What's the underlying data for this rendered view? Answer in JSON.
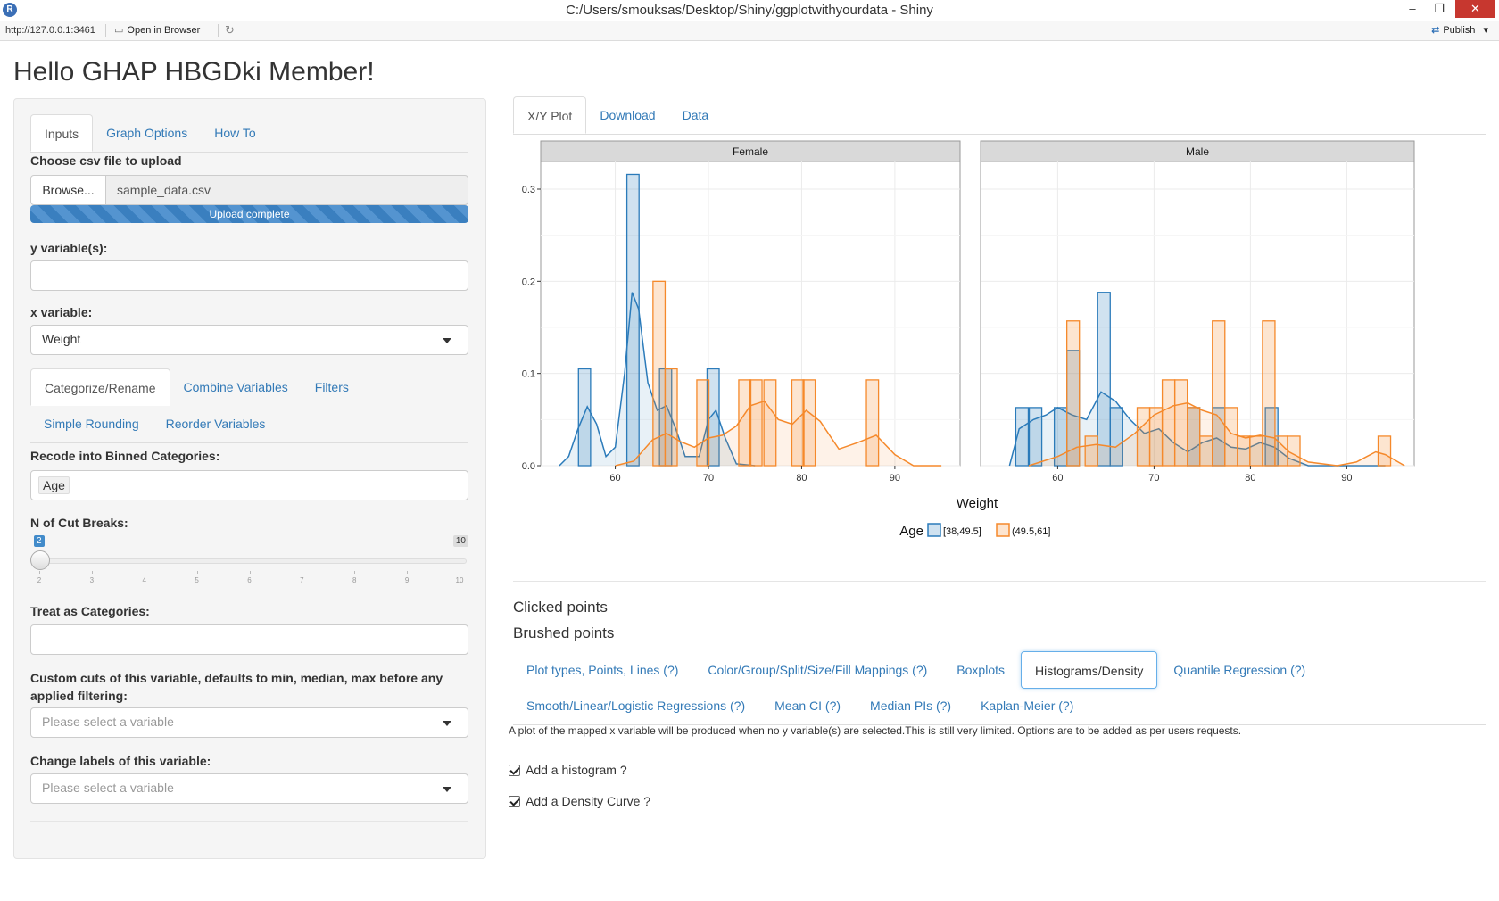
{
  "window": {
    "title": "C:/Users/smouksas/Desktop/Shiny/ggplotwithyourdata - Shiny",
    "app_icon": "R",
    "minimize": "–",
    "maximize": "❐",
    "close": "✕"
  },
  "addressbar": {
    "url": "http://127.0.0.1:3461",
    "open_in_browser": "Open in Browser",
    "publish": "Publish"
  },
  "page_title": "Hello GHAP HBGDki Member!",
  "sidebar": {
    "tabs": [
      "Inputs",
      "Graph Options",
      "How To"
    ],
    "upload_label": "Choose csv file to upload",
    "browse_label": "Browse...",
    "file_name": "sample_data.csv",
    "upload_status": "Upload complete",
    "y_label": "y variable(s):",
    "x_label": "x variable:",
    "x_value": "Weight",
    "sub_tabs_row1": [
      "Categorize/Rename",
      "Combine Variables",
      "Filters"
    ],
    "sub_tabs_row2": [
      "Simple Rounding",
      "Reorder Variables"
    ],
    "recode_label": "Recode into Binned Categories:",
    "recode_value": "Age",
    "cut_breaks_label": "N of Cut Breaks:",
    "slider": {
      "value": "2",
      "max": "10",
      "min_value": 2,
      "max_value": 10,
      "ticks": [
        "2",
        "3",
        "4",
        "5",
        "6",
        "7",
        "8",
        "9",
        "10"
      ]
    },
    "treat_label": "Treat as Categories:",
    "custom_cuts_label": "Custom cuts of this variable, defaults to min, median, max before any applied filtering:",
    "custom_cuts_placeholder": "Please select a variable",
    "change_labels_label": "Change labels of this variable:",
    "change_labels_placeholder": "Please select a variable"
  },
  "main": {
    "tabs": [
      "X/Y Plot",
      "Download",
      "Data"
    ],
    "clicked_points": "Clicked points",
    "brushed_points": "Brushed points",
    "pills_row1": [
      "Plot types, Points, Lines (?)",
      "Color/Group/Split/Size/Fill Mappings (?)",
      "Boxplots",
      "Histograms/Density",
      "Quantile Regression (?)"
    ],
    "pills_row2": [
      "Smooth/Linear/Logistic Regressions (?)",
      "Mean CI (?)",
      "Median PIs (?)",
      "Kaplan-Meier (?)"
    ],
    "description": "A plot of the mapped x variable will be produced when no y variable(s) are selected.This is still very limited. Options are to be added as per users requests.",
    "checkbox_histogram": "Add a histogram ?",
    "checkbox_density": "Add a Density Curve ?"
  },
  "chart_data": {
    "type": "bar",
    "xlabel": "Weight",
    "ylabel": "",
    "facets": [
      "Female",
      "Male"
    ],
    "xlim": [
      52,
      97
    ],
    "ylim": [
      0,
      0.33
    ],
    "xticks": [
      60,
      70,
      80,
      90
    ],
    "yticks": [
      0.0,
      0.1,
      0.2,
      0.3
    ],
    "ytick_labels": [
      "0.0",
      "0.1",
      "0.2",
      "0.3"
    ],
    "legend_title": "Age",
    "legend_position": "bottom",
    "grid": true,
    "colors": {
      "series1": "#2b7bba",
      "series2": "#f5892b",
      "strip": "#d9d9d9"
    },
    "series": [
      {
        "name": "[38,49.5]",
        "facet": "Female",
        "bins": [
          [
            56.7,
            0.105
          ],
          [
            61.9,
            0.316
          ],
          [
            65.4,
            0.105
          ],
          [
            70.5,
            0.105
          ]
        ],
        "density": [
          [
            54,
            0
          ],
          [
            55,
            0.01
          ],
          [
            56,
            0.04
          ],
          [
            57,
            0.064
          ],
          [
            58,
            0.045
          ],
          [
            59,
            0.01
          ],
          [
            60,
            0.02
          ],
          [
            61,
            0.1
          ],
          [
            61.8,
            0.188
          ],
          [
            62.5,
            0.17
          ],
          [
            63.5,
            0.09
          ],
          [
            64.5,
            0.06
          ],
          [
            65.5,
            0.065
          ],
          [
            66.5,
            0.04
          ],
          [
            67.5,
            0.01
          ],
          [
            69,
            0.01
          ],
          [
            70,
            0.05
          ],
          [
            70.8,
            0.06
          ],
          [
            71.8,
            0.03
          ],
          [
            73,
            0.002
          ],
          [
            75,
            0
          ]
        ]
      },
      {
        "name": "(49.5,61]",
        "facet": "Female",
        "bins": [
          [
            64.7,
            0.2
          ],
          [
            66,
            0.105
          ],
          [
            69.4,
            0.093
          ],
          [
            73.9,
            0.093
          ],
          [
            75.1,
            0.093
          ],
          [
            76.6,
            0.093
          ],
          [
            79.6,
            0.093
          ],
          [
            80.8,
            0.093
          ],
          [
            87.6,
            0.093
          ]
        ],
        "density": [
          [
            60,
            0
          ],
          [
            62,
            0.005
          ],
          [
            64,
            0.028
          ],
          [
            65.5,
            0.035
          ],
          [
            67,
            0.026
          ],
          [
            68.5,
            0.02
          ],
          [
            70,
            0.03
          ],
          [
            71.5,
            0.033
          ],
          [
            73,
            0.043
          ],
          [
            74.5,
            0.065
          ],
          [
            76,
            0.07
          ],
          [
            77.5,
            0.05
          ],
          [
            79,
            0.045
          ],
          [
            80.5,
            0.06
          ],
          [
            82,
            0.048
          ],
          [
            84,
            0.018
          ],
          [
            86,
            0.025
          ],
          [
            88,
            0.033
          ],
          [
            90,
            0.012
          ],
          [
            92,
            0
          ],
          [
            95,
            0
          ]
        ]
      },
      {
        "name": "[38,49.5]",
        "facet": "Male",
        "bins": [
          [
            56.3,
            0.063
          ],
          [
            57.7,
            0.063
          ],
          [
            60.3,
            0.063
          ],
          [
            61.6,
            0.125
          ],
          [
            64.8,
            0.188
          ],
          [
            66.1,
            0.063
          ],
          [
            74.1,
            0.063
          ],
          [
            76.7,
            0.063
          ],
          [
            82.2,
            0.063
          ]
        ],
        "density": [
          [
            55,
            0
          ],
          [
            56,
            0.04
          ],
          [
            57.5,
            0.05
          ],
          [
            58.8,
            0.055
          ],
          [
            60,
            0.063
          ],
          [
            61.5,
            0.055
          ],
          [
            63,
            0.05
          ],
          [
            64.5,
            0.08
          ],
          [
            66,
            0.07
          ],
          [
            67.5,
            0.05
          ],
          [
            69,
            0.035
          ],
          [
            70.5,
            0.04
          ],
          [
            72,
            0.025
          ],
          [
            73.5,
            0.015
          ],
          [
            75,
            0.025
          ],
          [
            76.5,
            0.03
          ],
          [
            78,
            0.02
          ],
          [
            79.5,
            0.018
          ],
          [
            81,
            0.025
          ],
          [
            82.5,
            0.02
          ],
          [
            84,
            0.008
          ],
          [
            86,
            0
          ],
          [
            94,
            0
          ]
        ]
      },
      {
        "name": "(49.5,61]",
        "facet": "Male",
        "bins": [
          [
            61.6,
            0.157
          ],
          [
            63.5,
            0.032
          ],
          [
            68.9,
            0.063
          ],
          [
            70.2,
            0.063
          ],
          [
            71.5,
            0.093
          ],
          [
            72.8,
            0.093
          ],
          [
            74.1,
            0.063
          ],
          [
            75.4,
            0.032
          ],
          [
            76.7,
            0.157
          ],
          [
            78,
            0.063
          ],
          [
            79.3,
            0.032
          ],
          [
            80.6,
            0.032
          ],
          [
            81.9,
            0.157
          ],
          [
            83.2,
            0.032
          ],
          [
            84.5,
            0.032
          ],
          [
            93.9,
            0.032
          ]
        ],
        "density": [
          [
            57,
            0
          ],
          [
            60,
            0.01
          ],
          [
            62,
            0.02
          ],
          [
            64,
            0.023
          ],
          [
            66,
            0.02
          ],
          [
            68,
            0.035
          ],
          [
            70,
            0.055
          ],
          [
            72,
            0.065
          ],
          [
            73.5,
            0.068
          ],
          [
            75,
            0.06
          ],
          [
            76.5,
            0.055
          ],
          [
            78,
            0.035
          ],
          [
            79.5,
            0.03
          ],
          [
            81,
            0.033
          ],
          [
            82.5,
            0.03
          ],
          [
            84,
            0.015
          ],
          [
            86,
            0.004
          ],
          [
            89,
            0
          ],
          [
            91,
            0.004
          ],
          [
            93,
            0.015
          ],
          [
            94,
            0.012
          ],
          [
            96,
            0
          ]
        ]
      }
    ]
  }
}
